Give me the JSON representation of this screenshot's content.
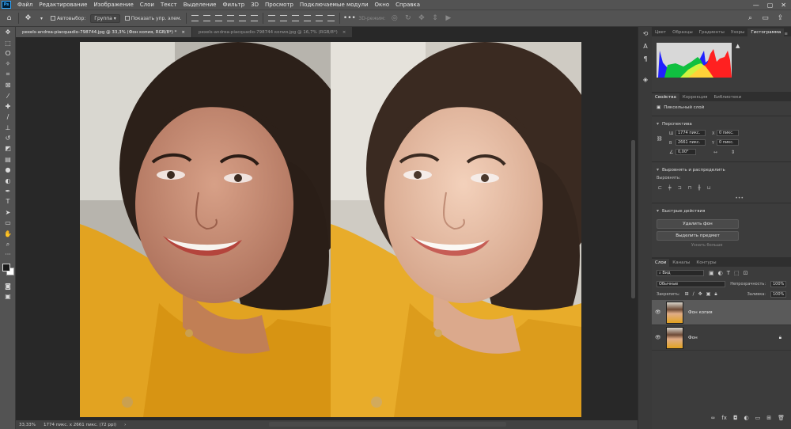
{
  "menubar": {
    "logo": "Ps",
    "items": [
      "Файл",
      "Редактирование",
      "Изображение",
      "Слои",
      "Текст",
      "Выделение",
      "Фильтр",
      "3D",
      "Просмотр",
      "Подключаемые модули",
      "Окно",
      "Справка"
    ],
    "window_controls": [
      "—",
      "▢",
      "✕"
    ]
  },
  "options": {
    "autoselect_label": "Автовыбор:",
    "group_value": "Группа",
    "show_controls_label": "Показать упр. элем.",
    "mode_label": "3D-режим:"
  },
  "tabs": [
    {
      "label": "pexels-andrea-piacquadio-798744.jpg @ 33,3% (Фон копия, RGB/8*) *",
      "close": "×"
    },
    {
      "label": "pexels-andrea-piacquadio-798744 копия.jpg @ 16,7% (RGB/8*)",
      "close": "×"
    }
  ],
  "status": {
    "zoom": "33,33%",
    "info": "1774 пикс. x 2661 пикс. (72 ppi)",
    "arrow": "›"
  },
  "panels": {
    "top_tabs": [
      "Цвет",
      "Образцы",
      "Градиенты",
      "Узоры",
      "Гистограмма"
    ],
    "top_tabs_active": 4,
    "more": "≡",
    "props_tabs": [
      "Свойства",
      "Коррекция",
      "Библиотеки"
    ],
    "props_tabs_active": 0,
    "pixel_layer": "Пиксельный слой",
    "transform_title": "Перспектива",
    "transform": {
      "w_label": "Ш",
      "w_value": "1774 пикс.",
      "x_label": "X",
      "x_value": "0 пикс.",
      "h_label": "В",
      "h_value": "2661 пикс.",
      "y_label": "Y",
      "y_value": "0 пикс.",
      "angle_value": "0,00°"
    },
    "align_title": "Выровнять и распределить",
    "align_label": "Выровнять:",
    "quick_title": "Быстрые действия",
    "quick_buttons": [
      "Удалить фон",
      "Выделить предмет"
    ],
    "quick_more": "Узнать больше",
    "layers_tabs": [
      "Слои",
      "Каналы",
      "Контуры"
    ],
    "layers_tabs_active": 0,
    "filter_value": "Вид",
    "blend_mode": "Обычные",
    "opacity_label": "Непрозрачность:",
    "opacity_value": "100%",
    "lock_label": "Закрепить:",
    "fill_label": "Заливка:",
    "fill_value": "100%",
    "layers": [
      {
        "name": "Фон копия",
        "selected": true
      },
      {
        "name": "Фон",
        "selected": false,
        "locked": true
      }
    ]
  },
  "colors": {
    "accent": "#31a8ff",
    "panel": "#3c3c3c",
    "shirt": "#e2a321"
  }
}
